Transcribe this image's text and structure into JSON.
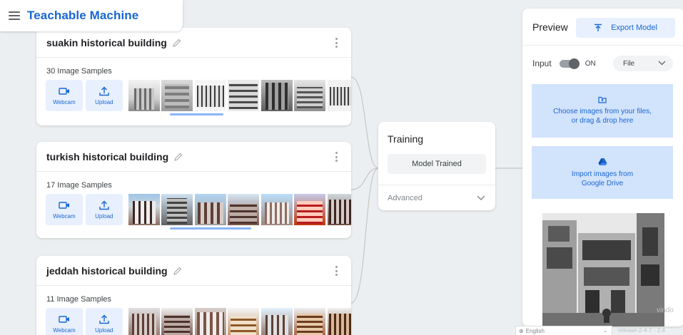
{
  "header": {
    "title": "Teachable Machine"
  },
  "classes": [
    {
      "name": "suakin historical building",
      "samples": "30 Image Samples",
      "webcam_label": "Webcam",
      "upload_label": "Upload",
      "scroll_fraction": 0.25
    },
    {
      "name": "turkish historical building",
      "samples": "17 Image Samples",
      "webcam_label": "Webcam",
      "upload_label": "Upload",
      "scroll_fraction": 0.38
    },
    {
      "name": "jeddah historical building",
      "samples": "11 Image Samples",
      "webcam_label": "Webcam",
      "upload_label": "Upload"
    }
  ],
  "training": {
    "title": "Training",
    "button": "Model Trained",
    "advanced": "Advanced"
  },
  "preview": {
    "title": "Preview",
    "export_label": "Export Model",
    "input_label": "Input",
    "toggle_state": "ON",
    "source": "File",
    "drop_line1": "Choose images from your files,",
    "drop_line2": "or drag & drop here",
    "drive_line1": "Import images from",
    "drive_line2": "Google Drive"
  },
  "footer": {
    "language": "English",
    "release": "release-2-4-7 - 2.4",
    "watermark": "vindo"
  },
  "colors": {
    "brand": "#1967d2",
    "button_bg": "#e8f0fe",
    "dropzone_bg": "#d2e3fc"
  },
  "icons": [
    "menu-icon",
    "pencil-icon",
    "more-vert-icon",
    "webcam-icon",
    "upload-icon",
    "export-icon",
    "chevron-down-icon",
    "folder-upload-icon",
    "google-drive-icon",
    "globe-icon"
  ]
}
